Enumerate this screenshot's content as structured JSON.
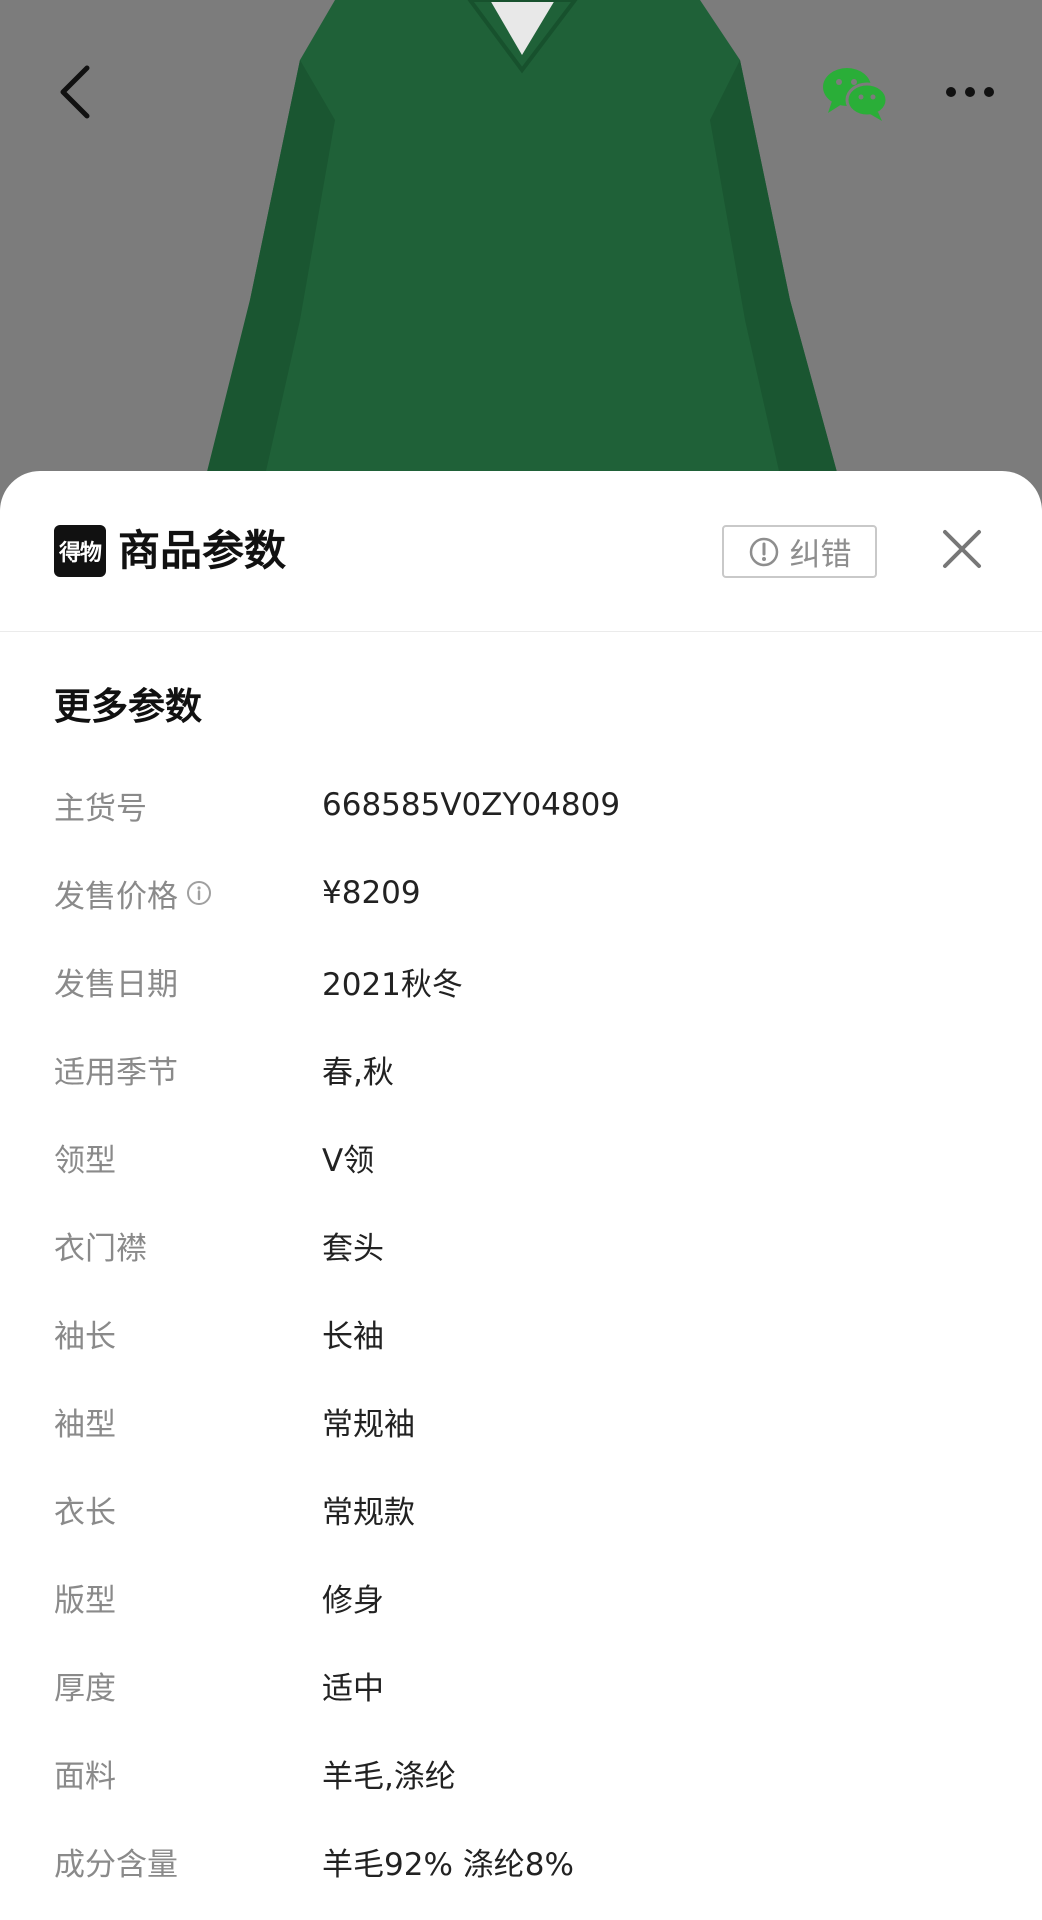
{
  "header": {
    "title": "商品参数",
    "brand_logo_text": "得物",
    "report_label": "纠错"
  },
  "section": {
    "title": "更多参数"
  },
  "params": [
    {
      "label": "主货号",
      "value": "668585V0ZY04809",
      "info": false
    },
    {
      "label": "发售价格",
      "value": "¥8209",
      "info": true
    },
    {
      "label": "发售日期",
      "value": "2021秋冬",
      "info": false
    },
    {
      "label": "适用季节",
      "value": "春,秋",
      "info": false
    },
    {
      "label": "领型",
      "value": "V领",
      "info": false
    },
    {
      "label": "衣门襟",
      "value": "套头",
      "info": false
    },
    {
      "label": "袖长",
      "value": "长袖",
      "info": false
    },
    {
      "label": "袖型",
      "value": "常规袖",
      "info": false
    },
    {
      "label": "衣长",
      "value": "常规款",
      "info": false
    },
    {
      "label": "版型",
      "value": "修身",
      "info": false
    },
    {
      "label": "厚度",
      "value": "适中",
      "info": false
    },
    {
      "label": "面料",
      "value": "羊毛,涤纶",
      "info": false
    },
    {
      "label": "成分含量",
      "value": "羊毛92% 涤纶8%",
      "info": false
    }
  ],
  "icons": {
    "back": "chevron-left-icon",
    "share": "wechat-icon",
    "more": "more-dots-icon",
    "close": "close-icon",
    "report": "exclamation-circle-icon",
    "info": "info-circle-icon"
  },
  "colors": {
    "sweater": "#1f6b3a",
    "wechat": "#2aae38",
    "label": "#8a8a8a",
    "value": "#222222"
  }
}
